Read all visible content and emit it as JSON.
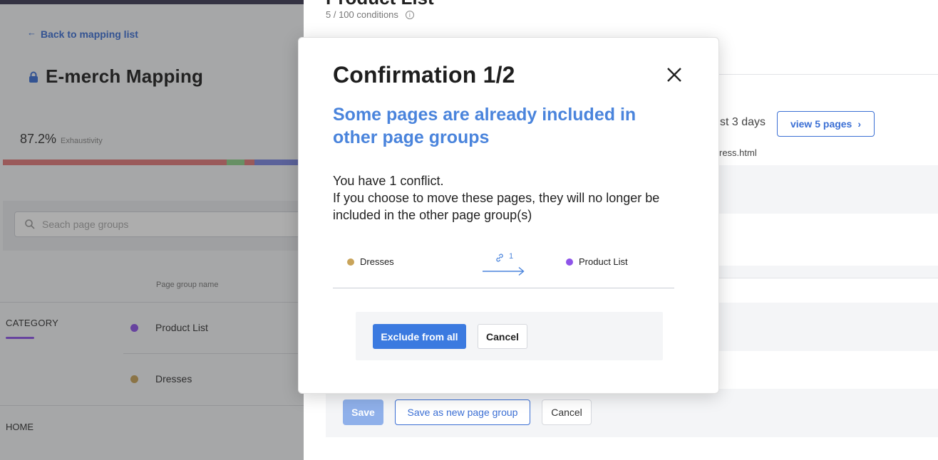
{
  "sidebar": {
    "back_label": "Back to mapping list",
    "title": "E-merch Mapping",
    "exhaustivity_value": "87.2%",
    "exhaustivity_label": "Exhaustivity",
    "search_placeholder": "Seach page groups",
    "column_header": "Page group name",
    "category_label": "CATEGORY",
    "groups": [
      {
        "name": "Product List",
        "color": "#8e54e9"
      },
      {
        "name": "Dresses",
        "color": "#c9a45a"
      }
    ],
    "home_label": "HOME",
    "bar_colors": [
      "#e07a7a",
      "#8fd18a",
      "#e07a7a",
      "#7b86e0"
    ]
  },
  "page": {
    "title": "Product List",
    "conditions": "5 / 100 conditions",
    "days_text": "st 3 days",
    "view_button": "view 5 pages",
    "url_fragment": "ress.html",
    "save_label": "Save",
    "save_as_label": "Save as new page group",
    "cancel_label": "Cancel"
  },
  "modal": {
    "title": "Confirmation 1/2",
    "subtitle": "Some pages are already included in other page groups",
    "body_line1": "You have 1 conflict.",
    "body_line2": "If you choose to move these pages, they will no longer be included in the other page group(s)",
    "source_group": "Dresses",
    "target_group": "Product List",
    "conflict_count": "1",
    "exclude_label": "Exclude from all",
    "cancel_label": "Cancel"
  },
  "colors": {
    "accent": "#3b7ae0",
    "subtitle": "#4a84dc",
    "dresses": "#c9a45a",
    "product_list": "#8e54e9"
  }
}
